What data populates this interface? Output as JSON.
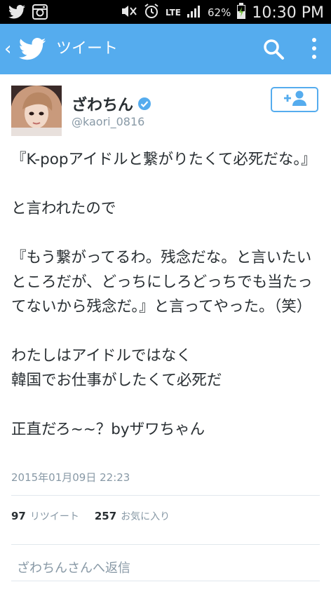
{
  "status_bar": {
    "battery_percent": "62%",
    "network": "LTE",
    "time": "10:30 PM",
    "icons": [
      "twitter-icon",
      "instagram-icon",
      "mute-icon",
      "alarm-icon",
      "signal-icon",
      "battery-charging-icon"
    ]
  },
  "app_bar": {
    "back_glyph": "‹",
    "title": "ツイート",
    "color": "#55acee"
  },
  "tweet": {
    "user_name": "ざわちん",
    "user_handle": "@kaori_0816",
    "verified": true,
    "text": "『K-popアイドルと繋がりたくて必死だな。』\n\nと言われたので\n\n『もう繋がってるわ。残念だな。と言いたいところだが、どっちにしろどっちでも当たってないから残念だ。』と言ってやった。（笑）\n\nわたしはアイドルではなく\n韓国でお仕事がしたくて必死だ\n\n正直だろ~~？byザワちゃん",
    "date": "2015年01月09日 22:23"
  },
  "stats": {
    "retweet_count": "97",
    "retweet_label": "リツイート",
    "favorite_count": "257",
    "favorite_label": "お気に入り"
  },
  "reply": {
    "placeholder": "ざわちんさんへ返信"
  }
}
